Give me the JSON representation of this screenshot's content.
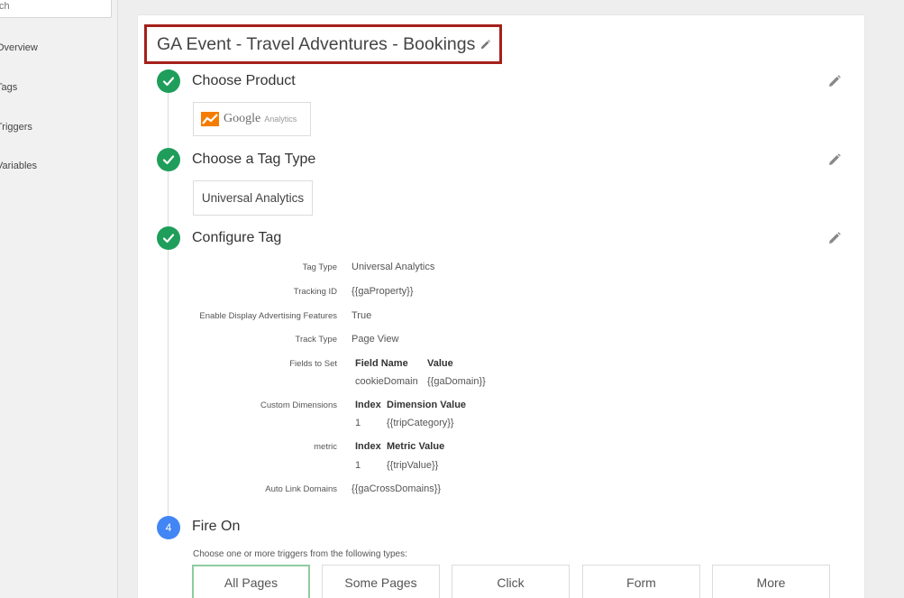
{
  "sidebar": {
    "search_placeholder": "ch",
    "items": [
      {
        "label": "Overview"
      },
      {
        "label": "Tags"
      },
      {
        "label": "Triggers"
      },
      {
        "label": "Variables"
      }
    ]
  },
  "tag": {
    "title": "GA Event - Travel Adventures - Bookings"
  },
  "steps": {
    "product": {
      "title": "Choose Product",
      "logo_word": "Google",
      "logo_sub": "Analytics"
    },
    "tag_type": {
      "title": "Choose a Tag Type",
      "value": "Universal Analytics"
    },
    "configure": {
      "title": "Configure Tag",
      "rows": {
        "tag_type": {
          "label": "Tag Type",
          "value": "Universal Analytics"
        },
        "tracking_id": {
          "label": "Tracking ID",
          "value": "{{gaProperty}}"
        },
        "display_ads": {
          "label": "Enable Display Advertising Features",
          "value": "True"
        },
        "track_type": {
          "label": "Track Type",
          "value": "Page View"
        },
        "fields_to_set": {
          "label": "Fields to Set",
          "headers": [
            "Field Name",
            "Value"
          ],
          "rows": [
            [
              "cookieDomain",
              "{{gaDomain}}"
            ]
          ]
        },
        "custom_dimensions": {
          "label": "Custom Dimensions",
          "headers": [
            "Index",
            "Dimension Value"
          ],
          "rows": [
            [
              "1",
              "{{tripCategory}}"
            ]
          ]
        },
        "metric": {
          "label": "metric",
          "headers": [
            "Index",
            "Metric Value"
          ],
          "rows": [
            [
              "1",
              "{{tripValue}}"
            ]
          ]
        },
        "auto_link": {
          "label": "Auto Link Domains",
          "value": "{{gaCrossDomains}}"
        }
      }
    },
    "fire_on": {
      "number": "4",
      "title": "Fire On",
      "hint": "Choose one or more triggers from the following types:",
      "triggers": [
        {
          "label": "All Pages",
          "selected": true
        },
        {
          "label": "Some Pages",
          "selected": false
        },
        {
          "label": "Click",
          "selected": false
        },
        {
          "label": "Form",
          "selected": false
        },
        {
          "label": "More",
          "selected": false
        }
      ]
    }
  },
  "colors": {
    "done": "#1e9e5a",
    "step_number": "#4285f4",
    "title_highlight": "#a5201b",
    "selected_trigger": "#8ecb9f"
  },
  "icons": {
    "step_done": "check-icon",
    "edit": "pencil-icon",
    "product_logo": "google-analytics-logo"
  }
}
